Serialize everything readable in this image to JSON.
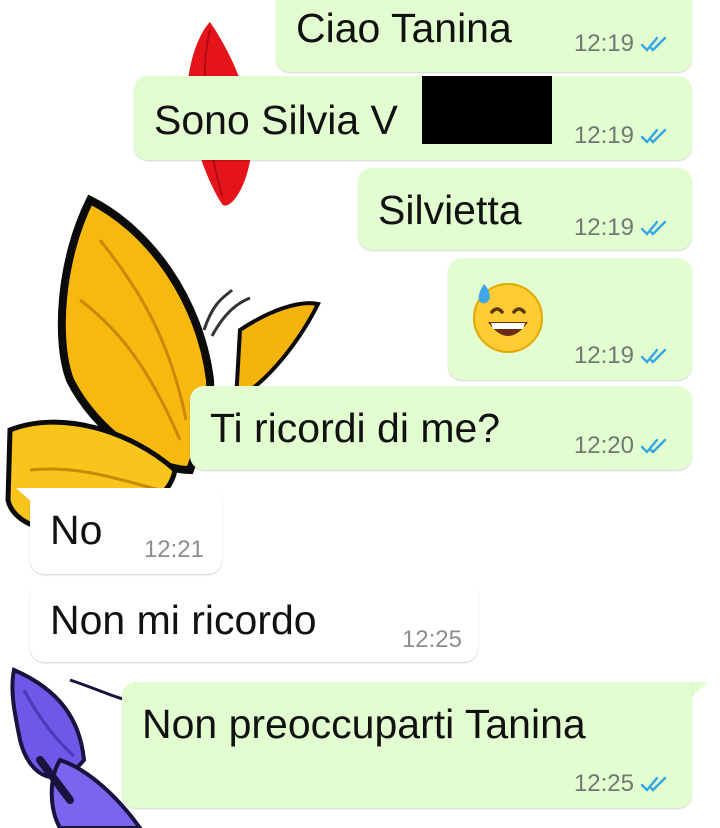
{
  "chat": {
    "messages": [
      {
        "direction": "outgoing",
        "text": "Ciao Tanina",
        "time": "12:19",
        "status": "read"
      },
      {
        "direction": "outgoing",
        "text": "Sono Silvia V",
        "time": "12:19",
        "status": "read",
        "note": "surname covered by a black redaction box"
      },
      {
        "direction": "outgoing",
        "text": "Silvietta",
        "time": "12:19",
        "status": "read"
      },
      {
        "direction": "outgoing",
        "emoji": "grinning-face-with-sweat",
        "time": "12:19",
        "status": "read"
      },
      {
        "direction": "outgoing",
        "text": "Ti ricordi di me?",
        "time": "12:20",
        "status": "read"
      },
      {
        "direction": "incoming",
        "text": "No",
        "time": "12:21"
      },
      {
        "direction": "incoming",
        "text": "Non mi ricordo",
        "time": "12:25"
      },
      {
        "direction": "outgoing",
        "text": "Non preoccuparti Tanina",
        "time": "12:25",
        "status": "read"
      }
    ]
  },
  "colors": {
    "outgoing_bubble": "#e2fdd0",
    "incoming_bubble": "#ffffff",
    "read_ticks": "#34a8e6",
    "timestamp": "#6f7a73"
  },
  "icons": {
    "read_receipt": "double-check-icon",
    "wallpaper": [
      "red-petal",
      "yellow-butterfly",
      "purple-butterfly"
    ]
  }
}
